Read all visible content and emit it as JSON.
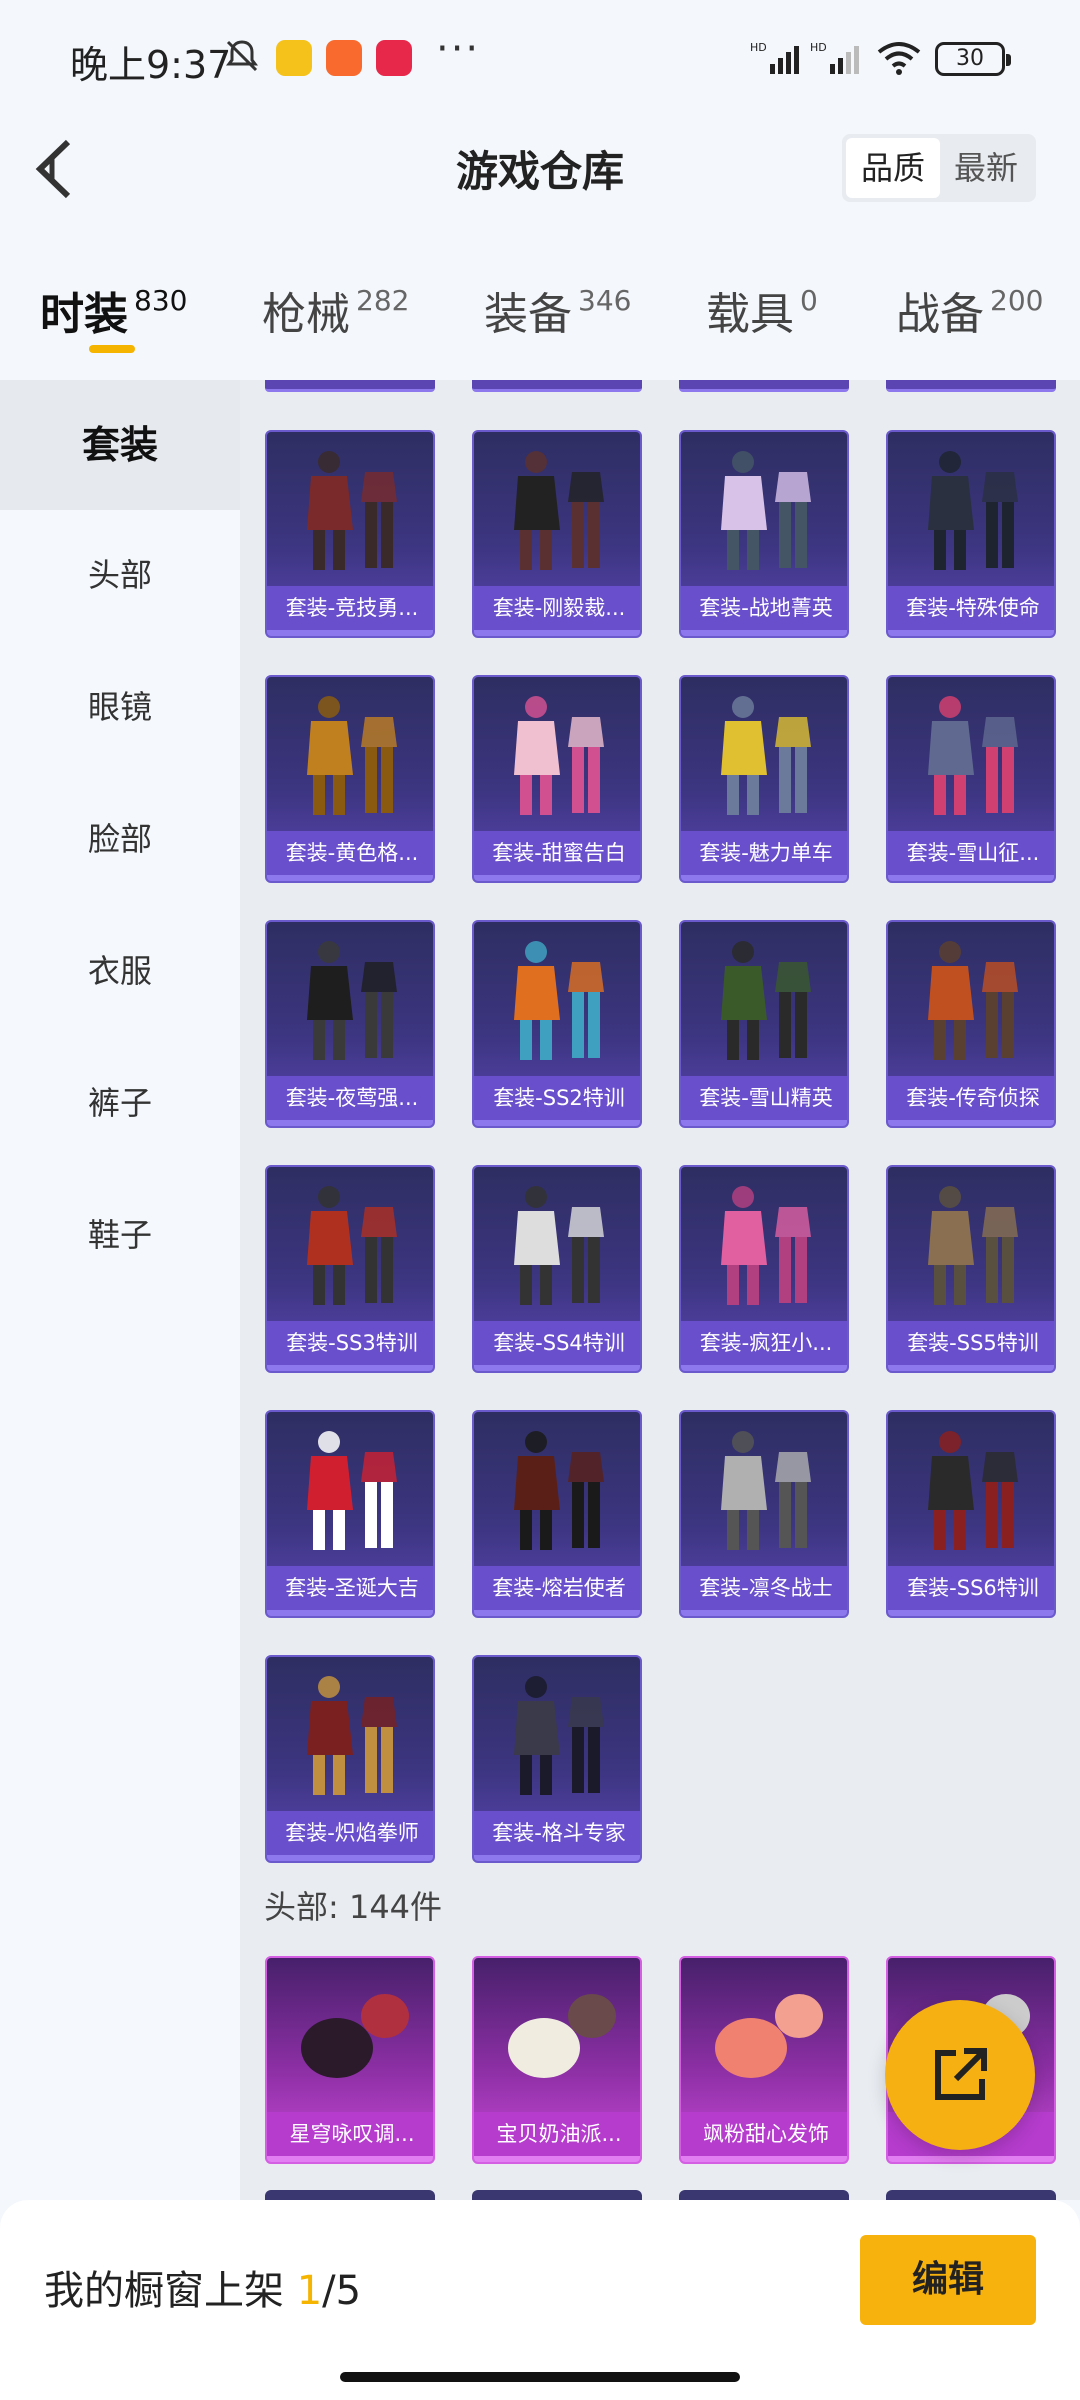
{
  "status_bar": {
    "time": "晚上9:37",
    "dots": "···",
    "battery": "30",
    "icons": [
      "bell-off-icon",
      "app-icon-yellow",
      "app-icon-orange",
      "app-icon-red",
      "signal-hd-1-icon",
      "signal-hd-2-icon",
      "wifi-icon",
      "battery-icon"
    ]
  },
  "header": {
    "title": "游戏仓库",
    "sort_options": [
      "品质",
      "最新"
    ],
    "sort_selected": "品质"
  },
  "tabs": [
    {
      "label": "时装",
      "count": "830",
      "active": true
    },
    {
      "label": "枪械",
      "count": "282"
    },
    {
      "label": "装备",
      "count": "346"
    },
    {
      "label": "载具",
      "count": "0"
    },
    {
      "label": "战备",
      "count": "200"
    }
  ],
  "sidebar": {
    "items": [
      "套装",
      "头部",
      "眼镜",
      "脸部",
      "衣服",
      "裤子",
      "鞋子"
    ],
    "active": "套装"
  },
  "suits": [
    "套装-竞技勇...",
    "套装-刚毅裁...",
    "套装-战地菁英",
    "套装-特殊使命",
    "套装-黄色格...",
    "套装-甜蜜告白",
    "套装-魅力单车",
    "套装-雪山征...",
    "套装-夜莺强...",
    "套装-SS2特训",
    "套装-雪山精英",
    "套装-传奇侦探",
    "套装-SS3特训",
    "套装-SS4特训",
    "套装-疯狂小...",
    "套装-SS5特训",
    "套装-圣诞大吉",
    "套装-熔岩使者",
    "套装-凛冬战士",
    "套装-SS6特训",
    "套装-炽焰拳师",
    "套装-格斗专家"
  ],
  "head_section": {
    "label": "头部: 144件",
    "items": [
      "星穹咏叹调...",
      "宝贝奶油派...",
      "飒粉甜心发饰",
      "...饰"
    ]
  },
  "bottom_bar": {
    "shelf_prefix": "我的橱窗上架 ",
    "shelf_current": "1",
    "shelf_total": "/5",
    "edit_label": "编辑"
  },
  "colors": {
    "accent": "#f5b400",
    "card_purple": "#5a45b3",
    "card_pink": "#c84ad6"
  }
}
